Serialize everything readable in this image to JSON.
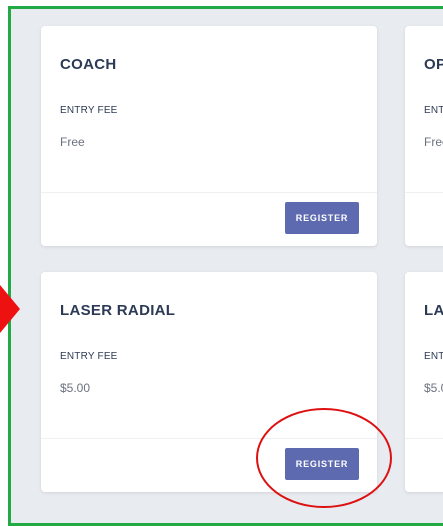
{
  "cards": [
    {
      "title": "COACH",
      "fee_label": "ENTRY FEE",
      "fee_value": "Free",
      "button": "REGISTER"
    },
    {
      "title": "OP",
      "fee_label": "ENT",
      "fee_value": "Free"
    },
    {
      "title": "LASER RADIAL",
      "fee_label": "ENTRY FEE",
      "fee_value": "$5.00",
      "button": "REGISTER"
    },
    {
      "title": "LA",
      "fee_label": "ENT",
      "fee_value": "$5.0"
    }
  ],
  "colors": {
    "frame_border": "#22aa44",
    "page_bg": "#e8ebf0",
    "button_bg": "#5e6ab0",
    "title_text": "#2d3a55",
    "annotation": "#ee1111"
  }
}
